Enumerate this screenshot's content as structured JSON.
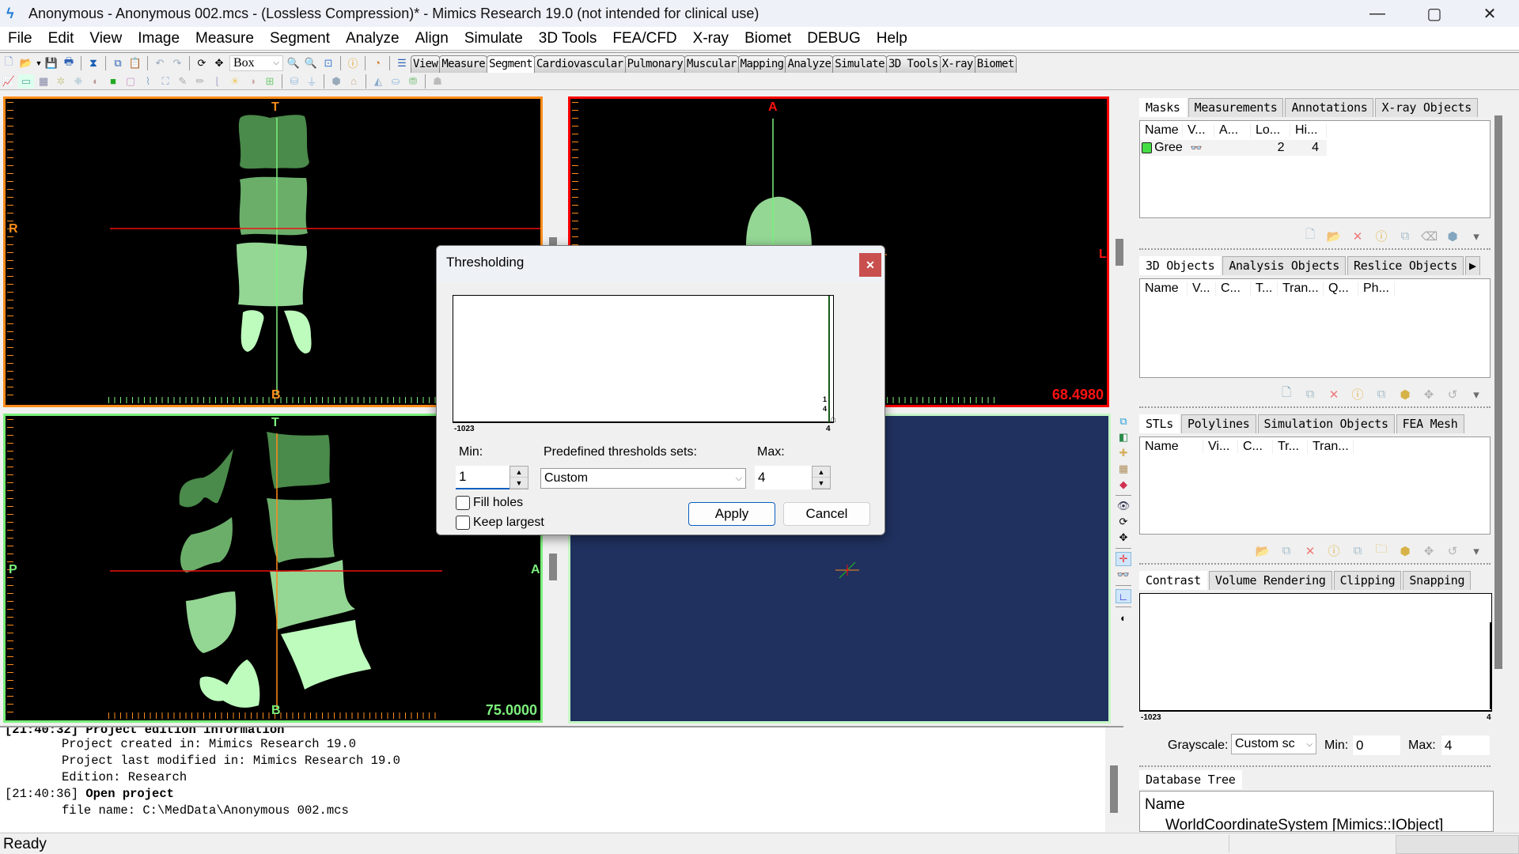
{
  "window": {
    "title": "Anonymous - Anonymous 002.mcs -  (Lossless Compression)* - Mimics Research 19.0 (not intended for clinical use)",
    "controls": {
      "minimize": "—",
      "restore": "▢",
      "close": "✕"
    }
  },
  "menu": [
    "File",
    "Edit",
    "View",
    "Image",
    "Measure",
    "Segment",
    "Analyze",
    "Align",
    "Simulate",
    "3D Tools",
    "FEA/CFD",
    "X-ray",
    "Biomet",
    "DEBUG",
    "Help"
  ],
  "toolbar": {
    "mode_combo": "Box",
    "ribbon_tabs": [
      "View",
      "Measure",
      "Segment",
      "Cardiovascular",
      "Pulmonary",
      "Muscular",
      "Mapping",
      "Analyze",
      "Simulate",
      "3D Tools",
      "X-ray",
      "Biomet"
    ],
    "active_ribbon_tab": "Segment"
  },
  "views": {
    "coronal": {
      "top": "T",
      "bottom": "B",
      "left": "R",
      "border": "#ff8c1a"
    },
    "axial": {
      "top": "A",
      "right": "L",
      "value": "68.4980",
      "border": "#ff0000"
    },
    "sagittal": {
      "top": "T",
      "bottom": "B",
      "left": "P",
      "right": "A",
      "value": "75.0000",
      "border": "#7cf07c"
    },
    "three_d": {
      "background": "#20315f",
      "border": "#c6f7c6"
    }
  },
  "side_toolbar_3d": [
    "layers-icon",
    "cube-icon",
    "objects-icon",
    "grid-icon",
    "clip-icon",
    "eye-icon",
    "rotate-icon",
    "pan-icon",
    "crosshair-icon",
    "glasses-icon",
    "axis-icon",
    "contrast-icon"
  ],
  "masks_panel": {
    "tabs": [
      "Masks",
      "Measurements",
      "Annotations",
      "X-ray Objects"
    ],
    "columns": [
      "Name",
      "V...",
      "A...",
      "Lo...",
      "Hi..."
    ],
    "rows": [
      {
        "name": "Gree",
        "color": "#44dd44",
        "visible": "glasses",
        "low": "2",
        "high": "4"
      }
    ]
  },
  "objects_panel": {
    "tabs": [
      "3D Objects",
      "Analysis Objects",
      "Reslice Objects"
    ],
    "columns": [
      "Name",
      "V...",
      "C...",
      "T...",
      "Tran...",
      "Q...",
      "Ph..."
    ]
  },
  "stl_panel": {
    "tabs": [
      "STLs",
      "Polylines",
      "Simulation Objects",
      "FEA Mesh"
    ],
    "columns": [
      "Name",
      "Vi...",
      "C...",
      "Tr...",
      "Tran..."
    ]
  },
  "contrast_panel": {
    "tabs": [
      "Contrast",
      "Volume Rendering",
      "Clipping",
      "Snapping"
    ],
    "axis_min": "-1023",
    "axis_max": "4",
    "grayscale_label": "Grayscale:",
    "grayscale_value": "Custom sc",
    "min_label": "Min:",
    "min_value": "0",
    "max_label": "Max:",
    "max_value": "4"
  },
  "database_panel": {
    "tabs": [
      "Database Tree"
    ],
    "header": "Name",
    "items": [
      "WorldCoordinateSystem [Mimics::IObject]"
    ]
  },
  "log": {
    "lines": [
      {
        "time": "[21:40:32]",
        "text": " Project edition information",
        "bold": true
      },
      {
        "indent": true,
        "text": "Project created in: Mimics Research 19.0"
      },
      {
        "indent": true,
        "text": "Project last modified in: Mimics Research 19.0"
      },
      {
        "indent": true,
        "text": "Edition: Research"
      },
      {
        "time": "[21:40:36]",
        "text": " Open project",
        "bold": true
      },
      {
        "indent": true,
        "text": "file name: C:\\MedData\\Anonymous 002.mcs"
      }
    ]
  },
  "status": {
    "text": "Ready"
  },
  "dialog": {
    "title": "Thresholding",
    "histogram": {
      "axis_min": "-1023",
      "axis_max": "4",
      "marker_min": "1",
      "marker_max": "4"
    },
    "min_label": "Min:",
    "min_value": "1",
    "predefined_label": "Predefined thresholds sets:",
    "predefined_value": "Custom",
    "max_label": "Max:",
    "max_value": "4",
    "fill_holes_label": "Fill holes",
    "fill_holes_checked": false,
    "keep_largest_label": "Keep largest",
    "keep_largest_checked": false,
    "apply_label": "Apply",
    "cancel_label": "Cancel"
  }
}
